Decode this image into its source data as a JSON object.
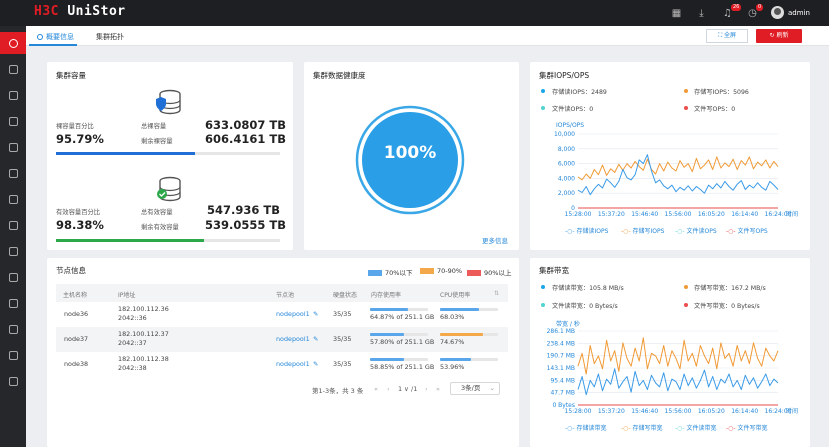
{
  "app": {
    "logo_left": "H3C",
    "logo_right": "UniStor",
    "username": "admin",
    "badge_alerts": "26",
    "badge_tasks": "0"
  },
  "tabs": [
    {
      "label": "概要信息"
    },
    {
      "label": "集群拓扑"
    }
  ],
  "toolbar": {
    "fullscreen_label": "全屏",
    "refresh_label": "刷新"
  },
  "capacity": {
    "title": "集群容量",
    "raw": {
      "pct_label": "裸容量百分比",
      "pct": "95.79%",
      "total_label": "总裸容量",
      "total": "633.0807 TB",
      "free_label": "剩余裸容量",
      "free": "606.4161 TB",
      "used_fraction": 0.62
    },
    "effective": {
      "pct_label": "有效容量百分比",
      "pct": "98.38%",
      "total_label": "总有效容量",
      "total": "547.936 TB",
      "free_label": "剩余有效容量",
      "free": "539.0555 TB",
      "used_fraction": 0.66
    }
  },
  "health": {
    "title": "集群数据健康度",
    "value": "100%",
    "more": "更多信息",
    "fraction": 1.0
  },
  "iops": {
    "title": "集群IOPS/OPS",
    "stats": [
      {
        "label": "存储读IOPS：2489",
        "color": "#1aa7e8"
      },
      {
        "label": "存储写IOPS：5096",
        "color": "#f09a36"
      },
      {
        "label": "文件读OPS：0",
        "color": "#52d3d0"
      },
      {
        "label": "文件写OPS：0",
        "color": "#ea4d4d"
      }
    ],
    "ylabel": "IOPS/OPS",
    "xlabel": "时间",
    "legend": [
      "存储读IOPS",
      "存储写IOPS",
      "文件读OPS",
      "文件写OPS"
    ]
  },
  "nodes": {
    "title": "节点信息",
    "legend": [
      {
        "label": "70%以下",
        "color": "#5aa6ea"
      },
      {
        "label": "70-90%",
        "color": "#f3a94a"
      },
      {
        "label": "90%以上",
        "color": "#ec5a5a"
      }
    ],
    "columns": [
      "主机名称",
      "IP地址",
      "节点池",
      "硬盘状态",
      "内存使用率",
      "CPU使用率"
    ],
    "rows": [
      {
        "host": "node36",
        "ip1": "182.100.112.36",
        "ip2": "2042::36",
        "pool": "nodepool1",
        "disk": "35/35",
        "mem": "64.87% of 251.1 GB",
        "mem_frac": 0.6487,
        "cpu": "68.03%",
        "cpu_frac": 0.6803
      },
      {
        "host": "node37",
        "ip1": "182.100.112.37",
        "ip2": "2042::37",
        "pool": "nodepool1",
        "disk": "35/35",
        "mem": "57.80% of 251.1 GB",
        "mem_frac": 0.578,
        "cpu": "74.67%",
        "cpu_frac": 0.7467
      },
      {
        "host": "node38",
        "ip1": "182.100.112.38",
        "ip2": "2042::38",
        "pool": "nodepool1",
        "disk": "35/35",
        "mem": "58.85% of 251.1 GB",
        "mem_frac": 0.5885,
        "cpu": "53.96%",
        "cpu_frac": 0.5396
      }
    ],
    "pagination": {
      "summary": "第1-3条，共 3 条",
      "page": "1",
      "total_pages": "/1",
      "page_size": "3条/页"
    }
  },
  "bandwidth": {
    "title": "集群带宽",
    "stats": [
      {
        "label": "存储读带宽：105.8 MB/s",
        "color": "#1aa7e8"
      },
      {
        "label": "存储写带宽：167.2 MB/s",
        "color": "#f09a36"
      },
      {
        "label": "文件读带宽：0 Bytes/s",
        "color": "#52d3d0"
      },
      {
        "label": "文件写带宽：0 Bytes/s",
        "color": "#ea4d4d"
      }
    ],
    "ylabel": "带宽 / 秒",
    "xlabel": "时间",
    "legend": [
      "存储读带宽",
      "存储写带宽",
      "文件读带宽",
      "文件写带宽"
    ]
  },
  "chart_data": [
    {
      "type": "line",
      "title": "集群IOPS/OPS",
      "ylabel": "IOPS/OPS",
      "xlabel": "时间",
      "ylim": [
        0,
        10000
      ],
      "yticks": [
        "10,000",
        "8,000",
        "6,000",
        "4,000",
        "2,000",
        "0"
      ],
      "xticks": [
        "15:28:00",
        "15:37:20",
        "15:46:40",
        "15:56:00",
        "16:05:20",
        "16:14:40",
        "16:24:00"
      ],
      "series": [
        {
          "name": "存储读IOPS",
          "color": "#3a9be8",
          "values": [
            2400,
            2100,
            2900,
            1800,
            2600,
            3200,
            2700,
            3900,
            3400,
            2800,
            3600,
            5200,
            4100,
            3800,
            4500,
            6500,
            6000,
            7200,
            5000,
            3400,
            3800,
            3000,
            2600,
            3100,
            2200,
            2800,
            2400,
            3000,
            2300,
            2900,
            2500,
            2000,
            3100,
            2600,
            3300,
            2700,
            3600,
            2900,
            2400,
            3200,
            3700,
            2500,
            3100,
            2700,
            3400,
            2800,
            2400,
            3600,
            3100,
            2500
          ]
        },
        {
          "name": "存储写IOPS",
          "color": "#f09a36",
          "values": [
            4200,
            3800,
            4600,
            4000,
            5200,
            4500,
            5800,
            4400,
            5300,
            4800,
            5900,
            5100,
            6000,
            5400,
            6300,
            5600,
            5100,
            6600,
            5200,
            4600,
            6000,
            5000,
            6200,
            5400,
            5000,
            6400,
            5500,
            6000,
            4900,
            6700,
            5300,
            5800,
            6500,
            5200,
            6900,
            5400,
            6100,
            5600,
            6600,
            5200,
            6400,
            5800,
            6900,
            5300,
            6200,
            5700,
            6500,
            5400,
            6300,
            5600
          ]
        },
        {
          "name": "文件读OPS",
          "color": "#52d3d0",
          "values": [
            0,
            0
          ]
        },
        {
          "name": "文件写OPS",
          "color": "#ea4d4d",
          "values": [
            0,
            0
          ]
        }
      ]
    },
    {
      "type": "line",
      "title": "集群带宽",
      "ylabel": "带宽 / 秒",
      "xlabel": "时间",
      "ylim": [
        0,
        286.1
      ],
      "yticks": [
        "286.1 MB",
        "238.4 MB",
        "190.7 MB",
        "143.1 MB",
        "95.4 MB",
        "47.7 MB",
        "0 Bytes"
      ],
      "xticks": [
        "15:28:00",
        "15:37:20",
        "15:46:40",
        "15:56:00",
        "16:05:20",
        "16:14:40",
        "16:24:00"
      ],
      "series": [
        {
          "name": "存储读带宽",
          "color": "#3a9be8",
          "values": [
            60,
            110,
            40,
            95,
            70,
            120,
            55,
            100,
            80,
            140,
            65,
            90,
            110,
            50,
            130,
            75,
            95,
            60,
            115,
            85,
            70,
            125,
            55,
            100,
            90,
            60,
            120,
            75,
            105,
            65,
            95,
            135,
            70,
            110,
            60,
            100,
            85,
            120,
            70,
            95,
            60,
            115,
            80,
            105,
            65,
            90,
            120,
            75,
            100,
            85
          ]
        },
        {
          "name": "存储写带宽",
          "color": "#f09a36",
          "values": [
            150,
            200,
            120,
            230,
            160,
            190,
            140,
            250,
            170,
            210,
            130,
            240,
            180,
            150,
            220,
            170,
            260,
            140,
            200,
            190,
            160,
            230,
            150,
            210,
            180,
            140,
            250,
            170,
            200,
            150,
            230,
            190,
            160,
            220,
            140,
            240,
            180,
            200,
            150,
            230,
            170,
            210,
            160,
            240,
            180,
            150,
            220,
            190,
            170,
            210
          ]
        },
        {
          "name": "文件读带宽",
          "color": "#52d3d0",
          "values": [
            0,
            0
          ]
        },
        {
          "name": "文件写带宽",
          "color": "#ea4d4d",
          "values": [
            0,
            0
          ]
        }
      ]
    }
  ]
}
